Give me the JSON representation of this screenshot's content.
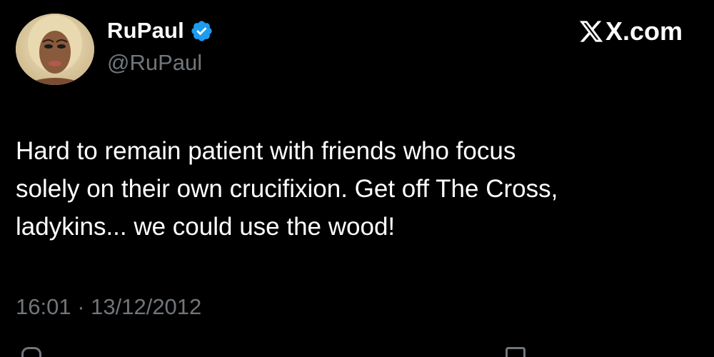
{
  "tweet": {
    "display_name": "RuPaul",
    "handle": "@RuPaul",
    "verified": true,
    "brand": "X.com",
    "text_lines": [
      "Hard to remain patient with friends who focus",
      "solely on their own crucifixion. Get off The Cross,",
      "ladykins... we could use the wood!"
    ],
    "timestamp": "16:01 · 13/12/2012"
  },
  "icons": {
    "avatar": "profile-photo",
    "verified": "verified-badge-icon",
    "brand": "x-logo-icon",
    "bottom_left": "reply-icon",
    "bottom_right": "bookmark-icon"
  },
  "colors": {
    "background": "#000000",
    "text_primary": "#ffffff",
    "text_secondary": "#71767b",
    "verified_blue": "#1d9bf0"
  }
}
